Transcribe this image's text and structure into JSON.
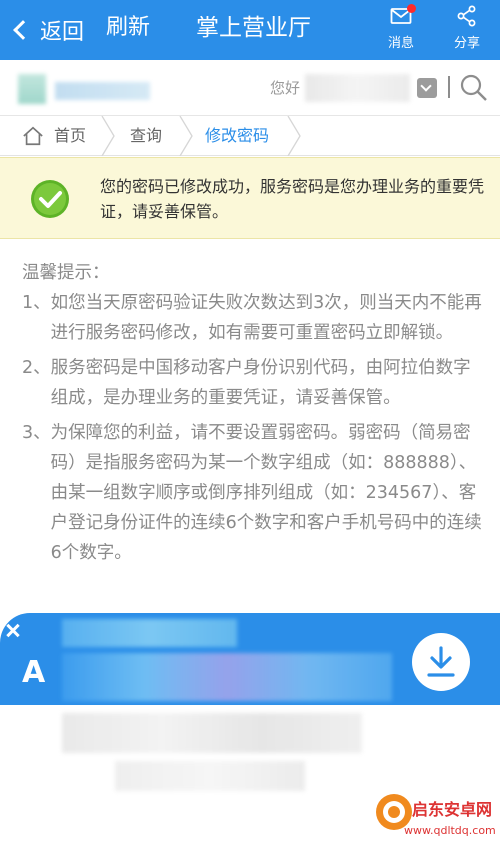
{
  "header": {
    "back_label": "返回",
    "refresh_label": "刷新",
    "title": "掌上营业厅",
    "messages_label": "消息",
    "share_label": "分享",
    "message_icon": "mail-icon",
    "share_icon": "share-icon"
  },
  "userbar": {
    "greeting": "您好"
  },
  "breadcrumb": {
    "home": "首页",
    "query": "查询",
    "current": "修改密码"
  },
  "notice": {
    "message": "您的密码已修改成功，服务密码是您办理业务的重要凭证，请妥善保管。",
    "icon": "check-circle-icon"
  },
  "tips": {
    "title": "温馨提示：",
    "items": [
      {
        "num": "1、",
        "text": "如您当天原密码验证失败次数达到3次，则当天内不能再进行服务密码修改，如有需要可重置密码立即解锁。"
      },
      {
        "num": "2、",
        "text": "服务密码是中国移动客户身份识别代码，由阿拉伯数字组成，是办理业务的重要凭证，请妥善保管。"
      },
      {
        "num": "3、",
        "text": "为保障您的利益，请不要设置弱密码。弱密码（简易密码）是指服务密码为某一个数字组成（如：888888）、由某一组数字顺序或倒序排列组成（如：234567）、客户登记身份证件的连续6个数字和客户手机号码中的连续6个数字。"
      }
    ]
  },
  "ad": {
    "letter": "A",
    "download_icon": "download-icon"
  },
  "watermark": {
    "site_name": "启东安卓网",
    "url": "www.qdltdq.com"
  },
  "colors": {
    "primary": "#2b8ee8",
    "notice_bg": "#fbf8d8",
    "success_green": "#6cbf2e",
    "tip_text": "#8a8a8a"
  }
}
